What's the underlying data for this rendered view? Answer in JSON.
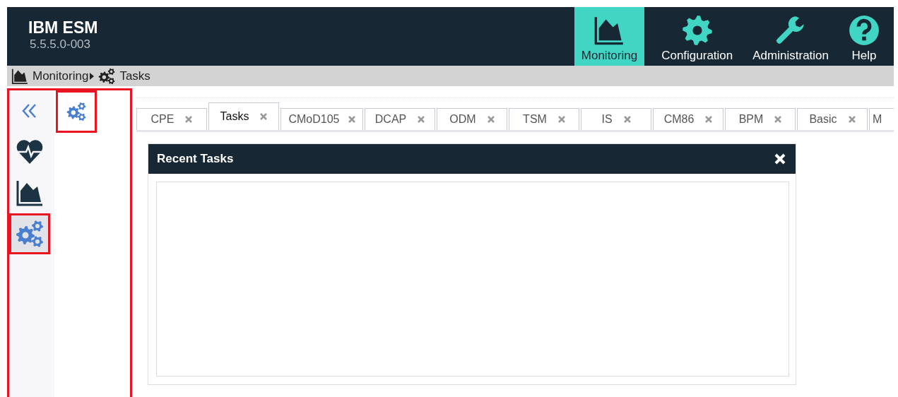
{
  "app": {
    "title": "IBM ESM",
    "version": "5.5.5.0-003"
  },
  "nav": [
    {
      "kind": "chart",
      "label": "Monitoring",
      "selected": true
    },
    {
      "kind": "gear",
      "label": "Configuration",
      "selected": false
    },
    {
      "kind": "wrench",
      "label": "Administration",
      "selected": false
    },
    {
      "kind": "help",
      "label": "Help",
      "selected": false
    }
  ],
  "breadcrumb": [
    {
      "kind": "chart",
      "label": "Monitoring"
    },
    {
      "kind": "gears",
      "label": "Tasks"
    }
  ],
  "sidebar": {
    "highlighted": true,
    "rail": [
      {
        "kind": "collapse",
        "selected": false,
        "highlighted": false
      },
      {
        "kind": "heart",
        "selected": false,
        "highlighted": false
      },
      {
        "kind": "chart",
        "selected": false,
        "highlighted": false
      },
      {
        "kind": "gears",
        "selected": true,
        "highlighted": true
      }
    ],
    "panel_items": [
      {
        "kind": "gears",
        "highlighted": true
      }
    ]
  },
  "tabs": [
    {
      "label": "CPE",
      "selected": false
    },
    {
      "label": "Tasks",
      "selected": true
    },
    {
      "label": "CMoD105",
      "selected": false
    },
    {
      "label": "DCAP",
      "selected": false
    },
    {
      "label": "ODM",
      "selected": false
    },
    {
      "label": "TSM",
      "selected": false
    },
    {
      "label": "IS",
      "selected": false
    },
    {
      "label": "CM86",
      "selected": false
    },
    {
      "label": "BPM",
      "selected": false
    },
    {
      "label": "Basic",
      "selected": false
    },
    {
      "label": "M",
      "selected": false
    }
  ],
  "panel": {
    "title": "Recent Tasks"
  }
}
